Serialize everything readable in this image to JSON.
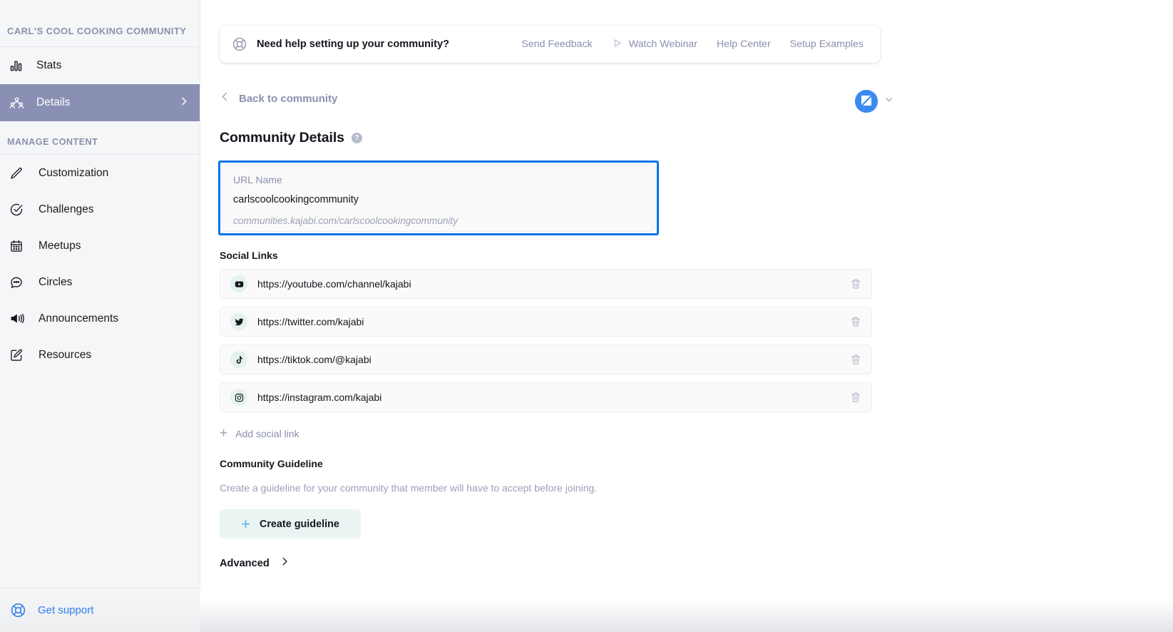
{
  "sidebar": {
    "brand": "CARL'S COOL COOKING COMMUNITY",
    "top_items": [
      {
        "label": "Stats",
        "icon": "bar-chart-icon",
        "active": false
      },
      {
        "label": "Details",
        "icon": "people-group-icon",
        "active": true
      }
    ],
    "section_label": "MANAGE CONTENT",
    "items": [
      {
        "label": "Customization",
        "icon": "pencil-icon"
      },
      {
        "label": "Challenges",
        "icon": "check-circle-icon"
      },
      {
        "label": "Meetups",
        "icon": "calendar-icon"
      },
      {
        "label": "Circles",
        "icon": "chat-bubble-icon"
      },
      {
        "label": "Announcements",
        "icon": "megaphone-icon"
      },
      {
        "label": "Resources",
        "icon": "edit-document-icon"
      }
    ],
    "support": {
      "label": "Get support",
      "icon": "lifebuoy-icon",
      "color": "#2f80ed"
    },
    "active_color": "#8a90b4",
    "background": "#f5f6f7"
  },
  "help_banner": {
    "icon": "lifebuoy-icon",
    "title": "Need help setting up your community?",
    "links": [
      {
        "label": "Send Feedback",
        "icon": ""
      },
      {
        "label": "Watch Webinar",
        "icon": "play-triangle-icon"
      },
      {
        "label": "Help Center",
        "icon": ""
      },
      {
        "label": "Setup Examples",
        "icon": ""
      }
    ]
  },
  "header": {
    "back_label": "Back to community",
    "back_icon": "chevron-left-icon",
    "avatar_icon": "kajabi-logo-icon",
    "avatar_chevron": "chevron-down-icon",
    "avatar_color": "#3b8af0"
  },
  "page": {
    "title": "Community Details",
    "help_icon": "question-mark-icon"
  },
  "url_field": {
    "label": "URL Name",
    "value": "carlscoolcookingcommunity",
    "hint": "communities.kajabi.com/carlscoolcookingcommunity",
    "focus_color": "#0b72e7"
  },
  "social": {
    "heading": "Social Links",
    "links": [
      {
        "platform": "youtube",
        "icon": "youtube-icon",
        "url": "https://youtube.com/channel/kajabi",
        "delete_icon": "trash-icon"
      },
      {
        "platform": "twitter",
        "icon": "twitter-icon",
        "url": "https://twitter.com/kajabi",
        "delete_icon": "trash-icon"
      },
      {
        "platform": "tiktok",
        "icon": "tiktok-icon",
        "url": "https://tiktok.com/@kajabi",
        "delete_icon": "trash-icon"
      },
      {
        "platform": "instagram",
        "icon": "instagram-icon",
        "url": "https://instagram.com/kajabi",
        "delete_icon": "trash-icon"
      }
    ],
    "add_label": "Add social link",
    "add_icon": "plus-icon"
  },
  "guideline": {
    "heading": "Community Guideline",
    "description": "Create a guideline for your community that member will have to accept before joining.",
    "button_label": "Create guideline",
    "button_icon": "plus-icon"
  },
  "advanced": {
    "label": "Advanced",
    "icon": "chevron-right-icon"
  }
}
